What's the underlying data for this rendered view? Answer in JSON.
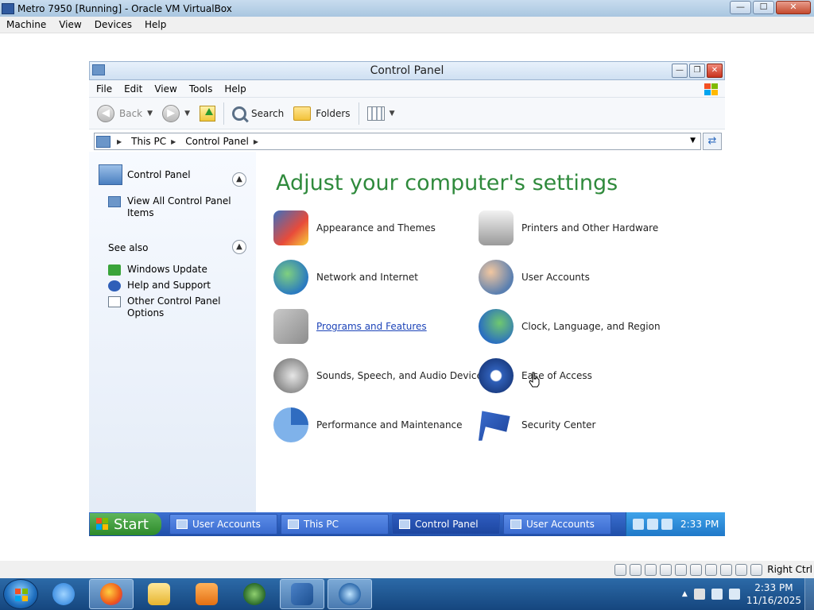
{
  "host_window": {
    "title": "Metro 7950 [Running] - Oracle VM VirtualBox",
    "controls": {
      "minimize": "—",
      "maximize": "☐",
      "close": "✕"
    },
    "menu": [
      "Machine",
      "View",
      "Devices",
      "Help"
    ]
  },
  "control_panel": {
    "title": "Control Panel",
    "menu": [
      "File",
      "Edit",
      "View",
      "Tools",
      "Help"
    ],
    "toolbar": {
      "back": "Back",
      "search": "Search",
      "folders": "Folders"
    },
    "address": {
      "crumbs": [
        "This PC",
        "Control Panel"
      ]
    },
    "sidebar": {
      "panel_title": "Control Panel",
      "view_all": "View All Control Panel Items",
      "see_also_title": "See also",
      "see_also": [
        "Windows Update",
        "Help and Support",
        "Other Control Panel Options"
      ]
    },
    "heading": "Adjust your computer's settings",
    "categories_left": [
      "Appearance and Themes",
      "Network and Internet",
      "Programs and Features",
      "Sounds, Speech, and Audio Devices",
      "Performance and Maintenance"
    ],
    "categories_right": [
      "Printers and Other Hardware",
      "User Accounts",
      "Clock, Language, and Region",
      "Ease of Access",
      "Security Center"
    ]
  },
  "guest_taskbar": {
    "start": "Start",
    "tasks": [
      "User Accounts",
      "This PC",
      "Control Panel",
      "User Accounts"
    ],
    "clock": "2:33 PM"
  },
  "vb_status": {
    "host_key": "Right Ctrl"
  },
  "host_taskbar": {
    "time": "2:33 PM",
    "date": "11/16/2025"
  },
  "icons": {
    "guest_flag_colors": [
      "#f25022",
      "#7fba00",
      "#00a4ef",
      "#ffb900"
    ]
  }
}
